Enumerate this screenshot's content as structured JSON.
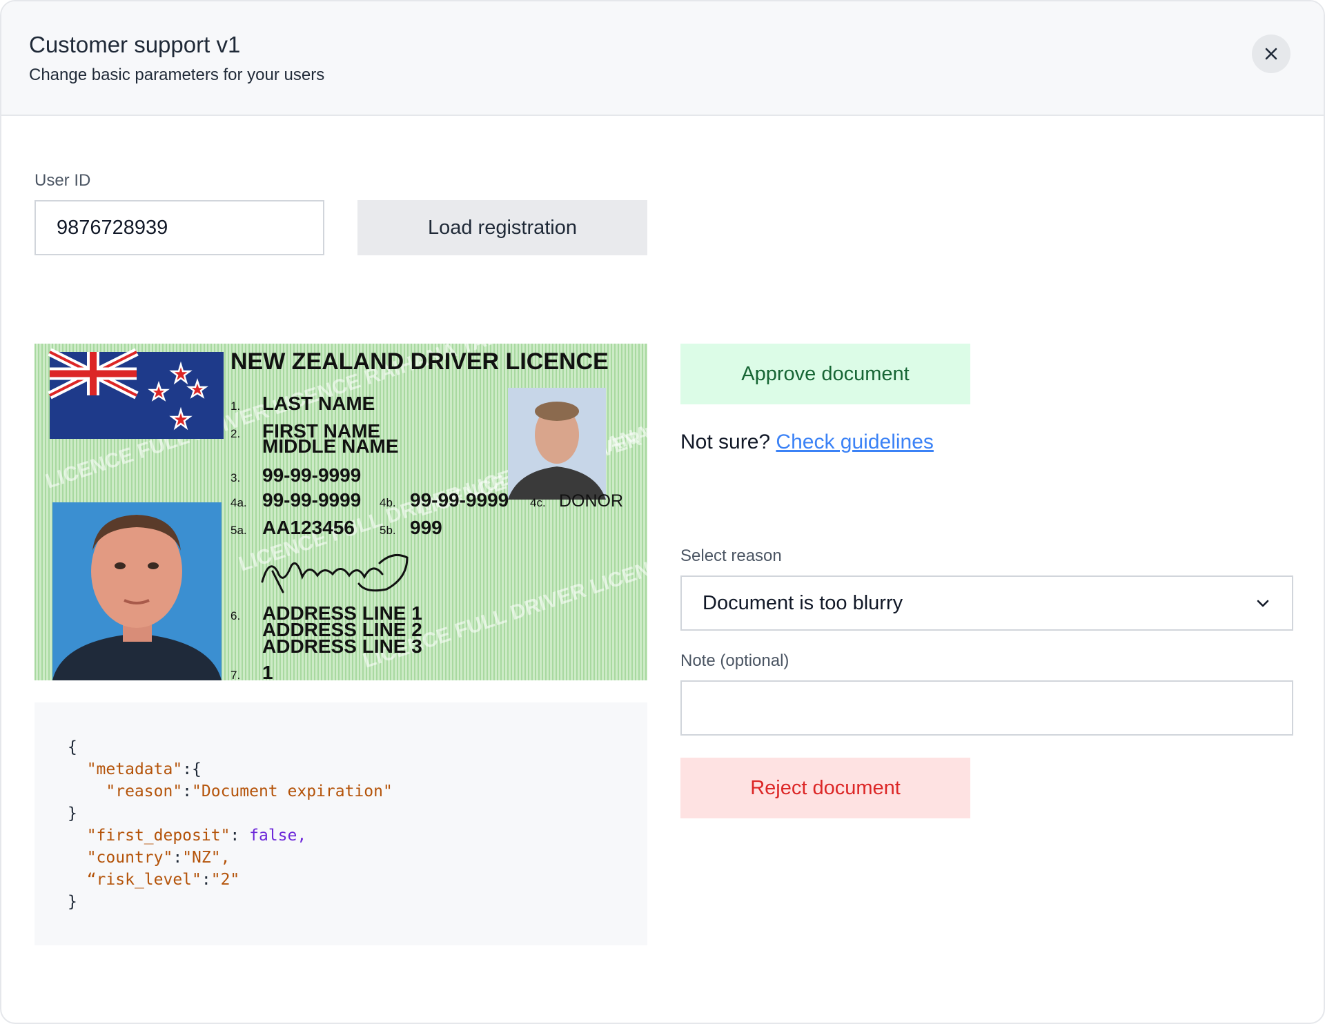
{
  "header": {
    "title": "Customer support v1",
    "subtitle": "Change basic parameters for your users",
    "close_icon": "close-icon"
  },
  "user_lookup": {
    "label": "User ID",
    "value": "9876728939",
    "load_button": "Load registration"
  },
  "license": {
    "header": "NEW ZEALAND DRIVER LICENCE",
    "fields": {
      "f1_num": "1.",
      "last_name": "LAST NAME",
      "f2_num": "2.",
      "first_name": "FIRST NAME",
      "middle_name": "MIDDLE NAME",
      "f3_num": "3.",
      "dob": "99-99-9999",
      "f4a_num": "4a.",
      "issue_date": "99-99-9999",
      "f4b_num": "4b.",
      "expiry_date": "99-99-9999",
      "f4c_num": "4c.",
      "donor": "DONOR",
      "f5a_num": "5a.",
      "licence_no": "AA123456",
      "f5b_num": "5b.",
      "version": "999",
      "f6_num": "6.",
      "address1": "ADDRESS LINE 1",
      "address2": "ADDRESS LINE 2",
      "address3": "ADDRESS LINE 3",
      "f7_num": "7.",
      "class": "1"
    },
    "signature": "Signature",
    "background_text": "LICENCE FULL DRIVER LICENCE RAIHANA TARAIWA TUTURU"
  },
  "metadata_json": {
    "line1": "{",
    "metadata_key": "\"metadata\"",
    "metadata_open": ":{",
    "reason_key": "\"reason\"",
    "reason_colon": ":",
    "reason_value": "\"Document expiration\"",
    "line_close1": "}",
    "first_deposit_key": "\"first_deposit\"",
    "first_deposit_colon": ": ",
    "first_deposit_value": "false,",
    "country_key": "\"country\"",
    "country_colon": ":",
    "country_value": "\"NZ\",",
    "risk_key": "“risk_level\"",
    "risk_colon": ":",
    "risk_value": "\"2\"",
    "line_close2": "}"
  },
  "actions": {
    "approve": "Approve document",
    "not_sure": "Not sure?",
    "guidelines_link": "Check guidelines",
    "reason_label": "Select reason",
    "reason_value": "Document is too blurry",
    "note_label": "Note (optional)",
    "note_value": "",
    "reject": "Reject document"
  },
  "colors": {
    "approve_bg": "#dcfce7",
    "approve_text": "#166534",
    "reject_bg": "#fee2e2",
    "reject_text": "#dc2626",
    "link": "#3b82f6",
    "license_green": "#b9e3b4"
  }
}
